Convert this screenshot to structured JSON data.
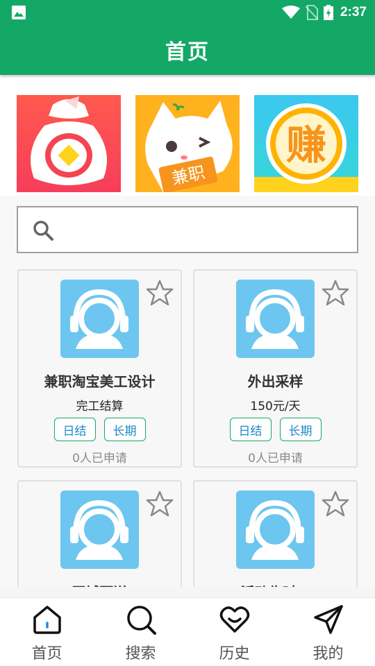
{
  "status_bar": {
    "time": "2:37",
    "icons": [
      "image-icon",
      "wifi-icon",
      "no-sim-icon",
      "battery-charging-icon"
    ]
  },
  "app_bar": {
    "title": "首页"
  },
  "banner": {
    "items": [
      {
        "name": "money-bag",
        "text": ""
      },
      {
        "name": "cat-part-time",
        "text": "兼职"
      },
      {
        "name": "earn-coin",
        "text": "赚"
      }
    ]
  },
  "search": {
    "placeholder": "",
    "value": ""
  },
  "jobs": [
    {
      "title": "兼职淘宝美工设计",
      "pay": "完工结算",
      "tags": [
        "日结",
        "长期"
      ],
      "applied": "0人已申请"
    },
    {
      "title": "外出采样",
      "pay": "150元/天",
      "tags": [
        "日结",
        "长期"
      ],
      "applied": "0人已申请"
    },
    {
      "title": "同城配送",
      "pay": "",
      "tags": [],
      "applied": ""
    },
    {
      "title": "活动临时工",
      "pay": "",
      "tags": [],
      "applied": ""
    }
  ],
  "nav": [
    {
      "label": "首页",
      "icon": "home-icon"
    },
    {
      "label": "搜索",
      "icon": "search-icon"
    },
    {
      "label": "历史",
      "icon": "heart-icon"
    },
    {
      "label": "我的",
      "icon": "send-icon"
    }
  ]
}
